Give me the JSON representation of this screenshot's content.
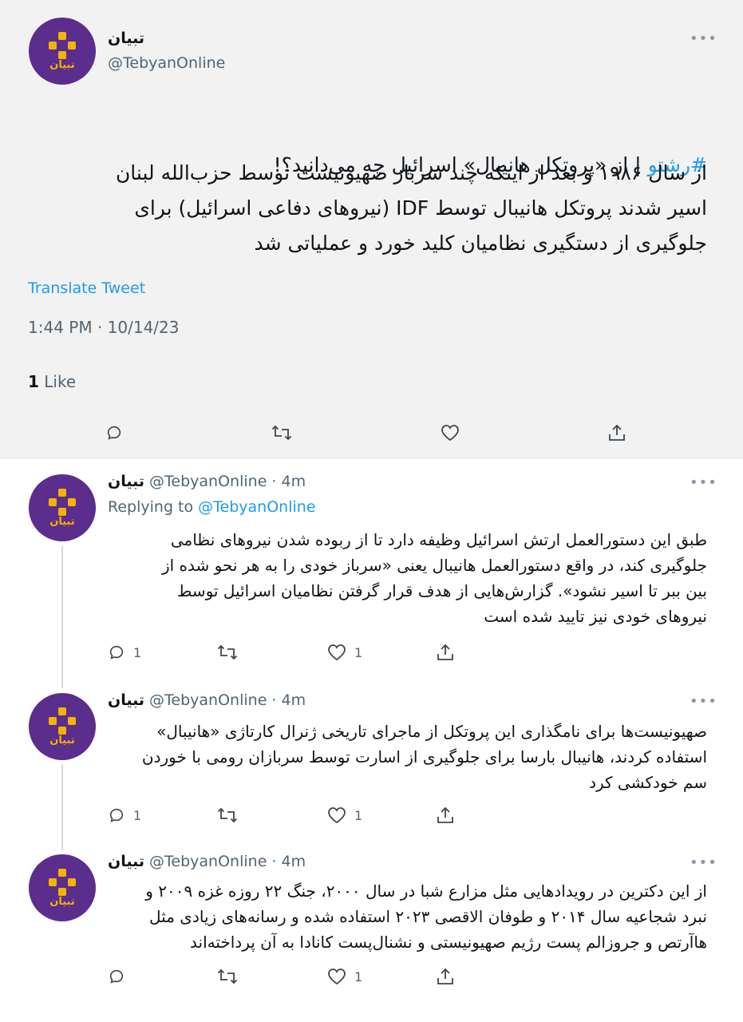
{
  "main_tweet": {
    "author_name": "تبیان",
    "handle": "@TebyanOnline",
    "more_icon": "more-dots-icon",
    "hashtag": "#رشتو",
    "headline_rest": " | از «پروتکل هانیبال» اسرائیل چه می‌دانید؟!",
    "body": "از سال ۱۹۸۶ و بعد از اینکه چند سرباز صهیونیست توسط حزب‌الله لبنان\nاسیر شدند پروتکل هانیبال توسط IDF (نیروهای دفاعی اسرائیل)  برای\nجلوگیری از دستگیری نظامیان کلید خورد و عملیاتی شد",
    "translate_label": "Translate Tweet",
    "timestamp": "1:44 PM · 10/14/23",
    "like_count": "1",
    "like_label": " Like"
  },
  "avatar": {
    "logo_text": "تبیان",
    "background": "#5b2d8c",
    "accent": "#f4b400"
  },
  "replies": [
    {
      "name": "تبیان",
      "handle_time": "@TebyanOnline · 4m",
      "replying_prefix": "Replying to ",
      "replying_to": "@TebyanOnline",
      "text": "طبق این دستورالعمل ارتش اسرائیل وظیفه دارد تا از ربوده شدن نیروهای نظامی\nجلوگیری کند، در واقع دستورالعمل هانیبال یعنی «سرباز خودی را به هر نحو شده از\nبین ببر تا اسیر نشود». گزارش‌هایی از هدف قرار گرفتن نظامیان اسرائیل توسط\nنیروهای خودی نیز تایید شده است",
      "reply_count": "1",
      "like_count": "1"
    },
    {
      "name": "تبیان",
      "handle_time": "@TebyanOnline · 4m",
      "text": "صهیونیست‌ها برای نامگذاری این پروتکل از ماجرای تاریخی ژنرال کارتاژی «هانیبال»\nاستفاده کردند، هانیبال بارسا برای جلوگیری از اسارت توسط سربازان رومی با خوردن\nسم خودکشی کرد",
      "reply_count": "1",
      "like_count": "1"
    },
    {
      "name": "تبیان",
      "handle_time": "@TebyanOnline · 4m",
      "text": "از این دکترین در رویدادهایی مثل مزارع شبا در سال ۲۰۰۰، جنگ ۲۲ روزه غزه ۲۰۰۹ و\nنبرد شجاعیه سال ۲۰۱۴ و طوفان الاقصی ۲۰۲۳ استفاده شده و رسانه‌های زیادی مثل\nهاآرتص و جروزالم پست رژیم صهیونیستی و نشنال‌پست کانادا به آن پرداخته‌اند",
      "reply_count": "",
      "like_count": "1"
    }
  ],
  "icons": {
    "reply": "reply-icon",
    "retweet": "retweet-icon",
    "like": "heart-icon",
    "share": "share-icon"
  },
  "colors": {
    "link": "#1d9bf0",
    "muted": "#536471",
    "main_bg": "#f2f2f2"
  }
}
